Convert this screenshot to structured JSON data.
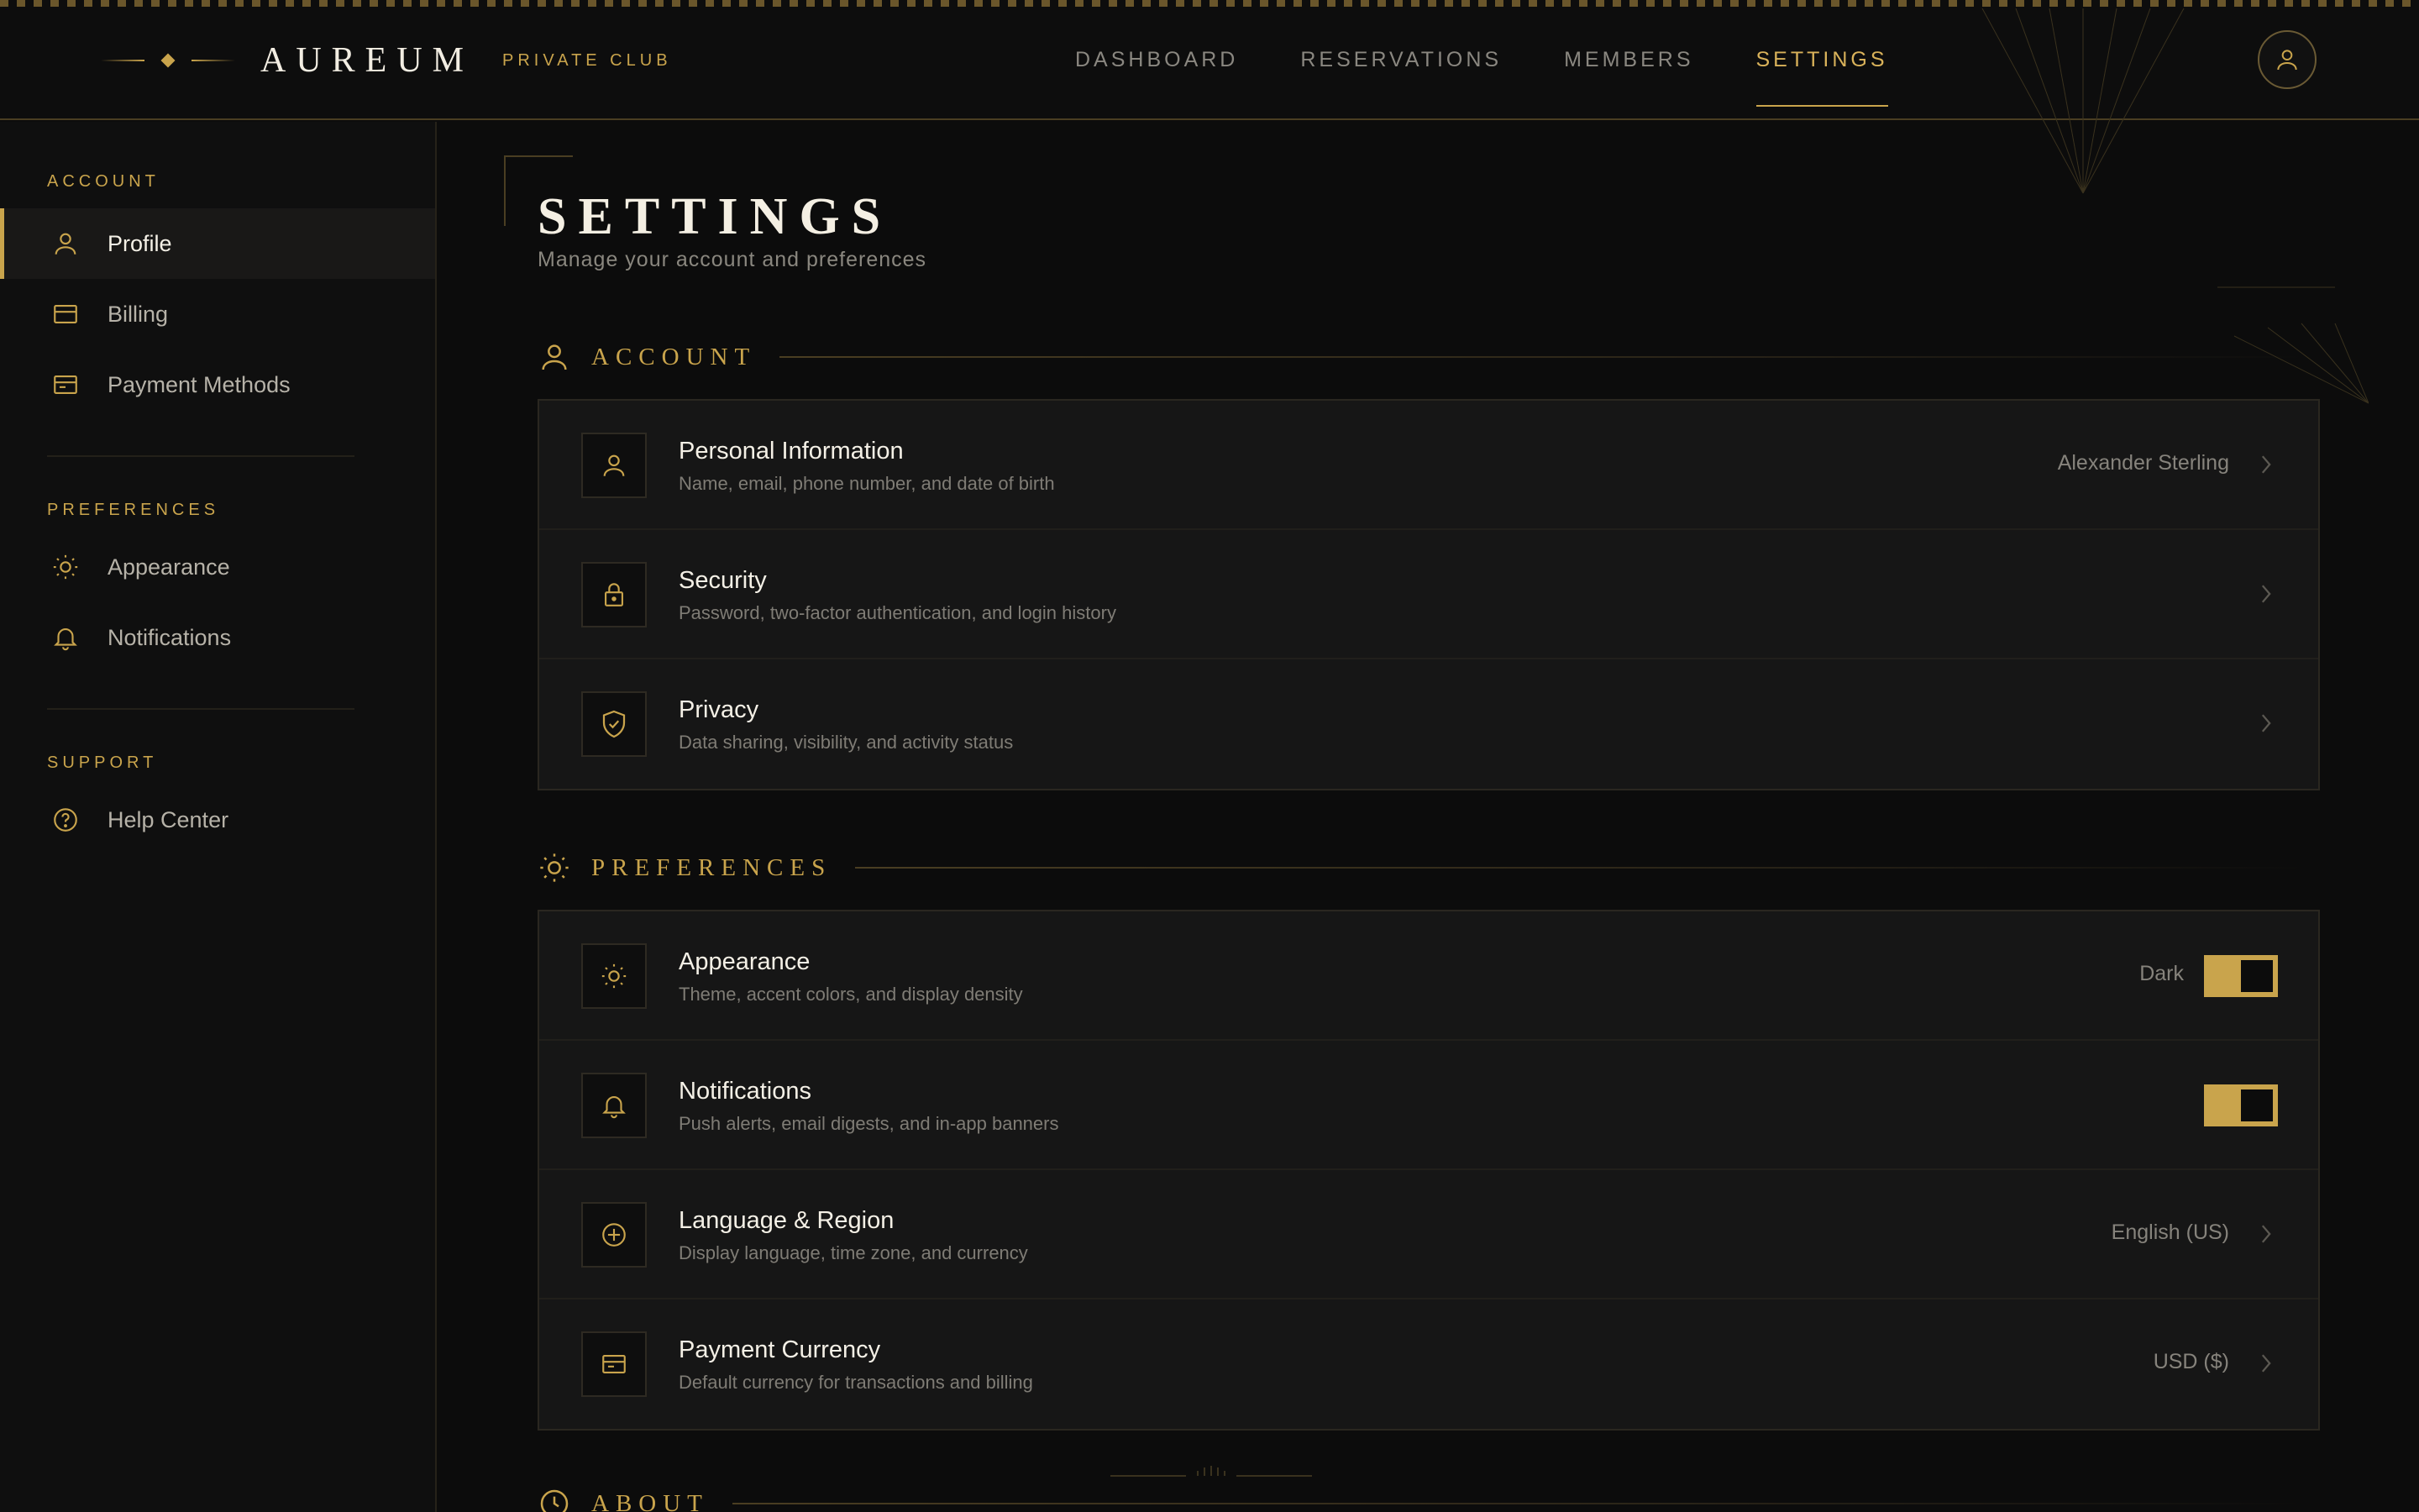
{
  "header": {
    "brand_name": "AUREUM",
    "brand_sub": "PRIVATE CLUB",
    "nav": [
      {
        "label": "DASHBOARD",
        "active": false
      },
      {
        "label": "RESERVATIONS",
        "active": false
      },
      {
        "label": "MEMBERS",
        "active": false
      },
      {
        "label": "SETTINGS",
        "active": true
      }
    ],
    "avatar_icon": "user-icon"
  },
  "sidebar": {
    "sections": [
      {
        "title": "ACCOUNT",
        "items": [
          {
            "label": "Profile",
            "icon": "user-icon",
            "active": true
          },
          {
            "label": "Billing",
            "icon": "card-icon",
            "active": false
          },
          {
            "label": "Payment Methods",
            "icon": "wallet-icon",
            "active": false
          }
        ]
      },
      {
        "title": "PREFERENCES",
        "items": [
          {
            "label": "Appearance",
            "icon": "sun-icon",
            "active": false
          },
          {
            "label": "Notifications",
            "icon": "bell-icon",
            "active": false
          }
        ]
      },
      {
        "title": "SUPPORT",
        "items": [
          {
            "label": "Help Center",
            "icon": "help-icon",
            "active": false
          }
        ]
      }
    ]
  },
  "main": {
    "title": "SETTINGS",
    "subtitle": "Manage your account and preferences",
    "account": {
      "heading": "ACCOUNT",
      "rows": [
        {
          "title": "Personal Information",
          "desc": "Name, email, phone number, and date of birth",
          "value": "Alexander Sterling",
          "icon": "user-icon"
        },
        {
          "title": "Security",
          "desc": "Password, two-factor authentication, and login history",
          "value": "",
          "icon": "lock-icon"
        },
        {
          "title": "Privacy",
          "desc": "Data sharing, visibility, and activity status",
          "value": "",
          "icon": "shield-check-icon"
        }
      ]
    },
    "preferences": {
      "heading": "PREFERENCES",
      "rows": [
        {
          "title": "Appearance",
          "desc": "Theme, accent colors, and display density",
          "value": "Dark",
          "icon": "sun-icon",
          "toggle": true
        },
        {
          "title": "Notifications",
          "desc": "Push alerts, email digests, and in-app banners",
          "value": "",
          "icon": "bell-icon",
          "toggle": true
        },
        {
          "title": "Language & Region",
          "desc": "Display language, time zone, and currency",
          "value": "English (US)",
          "icon": "globe-plus-icon"
        },
        {
          "title": "Payment Currency",
          "desc": "Default currency for transactions and billing",
          "value": "USD ($)",
          "icon": "card-icon"
        }
      ]
    },
    "about": {
      "heading": "ABOUT"
    }
  },
  "colors": {
    "accent": "#c9a44c",
    "background": "#0c0c0c",
    "card": "#161616",
    "text": "#f4f0e6",
    "muted": "#7f7c75"
  }
}
